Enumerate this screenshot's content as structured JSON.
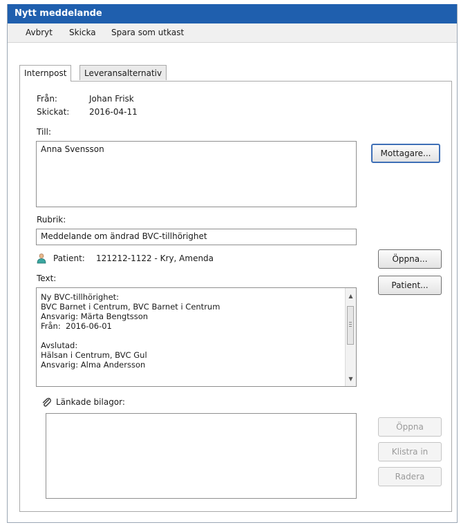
{
  "window": {
    "title": "Nytt meddelande"
  },
  "toolbar": {
    "cancel": "Avbryt",
    "send": "Skicka",
    "save_draft": "Spara som utkast"
  },
  "tabs": [
    {
      "label": "Internpost",
      "active": true
    },
    {
      "label": "Leveransalternativ",
      "active": false
    }
  ],
  "header": {
    "from_label": "Från:",
    "from_value": "Johan Frisk",
    "sent_label": "Skickat:",
    "sent_value": "2016-04-11"
  },
  "to": {
    "label": "Till:",
    "value": "Anna Svensson",
    "recipients_button": "Mottagare..."
  },
  "subject": {
    "label": "Rubrik:",
    "value": "Meddelande om ändrad BVC-tillhörighet"
  },
  "patient": {
    "label": "Patient:",
    "value": "121212-1122 - Kry, Amenda",
    "open_button": "Öppna...",
    "patient_button": "Patient..."
  },
  "text": {
    "label": "Text:",
    "lines": [
      "Ny BVC-tillhörighet:",
      "BVC Barnet i Centrum, BVC Barnet i Centrum",
      "Ansvarig: Märta Bengtsson",
      "Från:  2016-06-01",
      "",
      "Avslutad:",
      "Hälsan i Centrum, BVC Gul",
      "Ansvarig: Alma Andersson"
    ]
  },
  "attachments": {
    "label": "Länkade bilagor:",
    "open": "Öppna",
    "paste": "Klistra in",
    "delete": "Radera"
  },
  "colors": {
    "titlebar": "#1f5fae",
    "focus_border": "#3e6fb6",
    "disabled_text": "#9a9a9a"
  },
  "icons": {
    "patient": "person-icon",
    "attachment": "paperclip-icon"
  }
}
